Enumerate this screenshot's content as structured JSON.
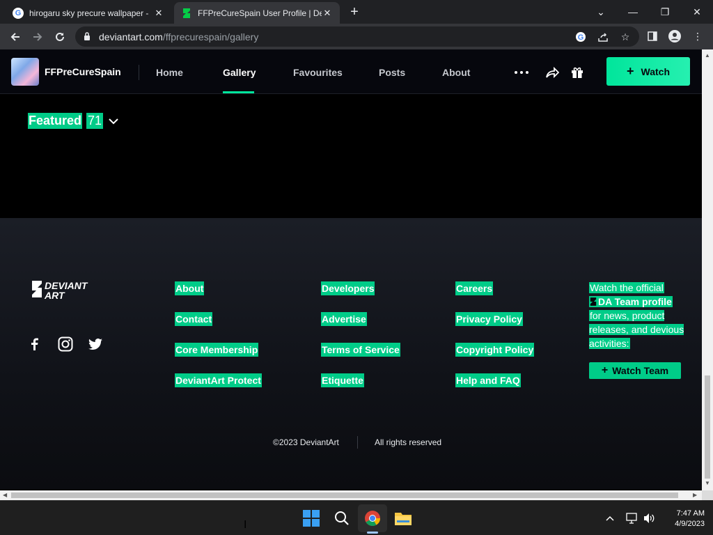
{
  "browser": {
    "tabs": [
      {
        "title": "hirogaru sky precure wallpaper -",
        "icon": "google-icon",
        "active": false
      },
      {
        "title": "FFPreCureSpain User Profile | De",
        "icon": "deviantart-icon",
        "active": true
      }
    ],
    "url_domain": "deviantart.com",
    "url_path": "/ffprecurespain/gallery"
  },
  "header": {
    "username": "FFPreCureSpain",
    "nav": [
      "Home",
      "Gallery",
      "Favourites",
      "Posts",
      "About"
    ],
    "active_nav": "Gallery",
    "watch_label": "Watch"
  },
  "main": {
    "section_label": "Featured",
    "section_count": "71"
  },
  "footer": {
    "columns": [
      [
        "About",
        "Contact",
        "Core Membership",
        "DeviantArt Protect"
      ],
      [
        "Developers",
        "Advertise",
        "Terms of Service",
        "Etiquette"
      ],
      [
        "Careers",
        "Privacy Policy",
        "Copyright Policy",
        "Help and FAQ"
      ]
    ],
    "promo_prefix": "Watch the official",
    "promo_link": "DA Team profile",
    "promo_suffix": "for news, product releases, and devious activities:",
    "watch_team_label": "Watch Team",
    "copyright": "©2023 DeviantArt",
    "rights": "All rights reserved"
  },
  "taskbar": {
    "time": "7:47 AM",
    "date": "4/9/2023"
  },
  "colors": {
    "accent": "#00cc88",
    "background": "#06070d"
  }
}
